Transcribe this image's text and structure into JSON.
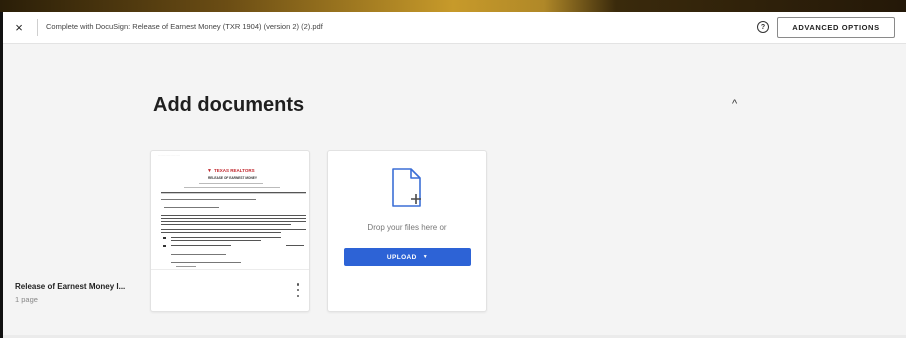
{
  "header": {
    "close_icon": "×",
    "document_title": "Complete with DocuSign: Release of Earnest Money (TXR 1904) (version 2) (2).pdf",
    "help_icon": "?",
    "advanced_options_label": "ADVANCED OPTIONS"
  },
  "section": {
    "title": "Add documents",
    "collapse_icon": "^"
  },
  "documents": [
    {
      "name": "Release of Earnest Money I...",
      "pages": "1 page",
      "more_icon": "more-vertical-icon"
    }
  ],
  "upload": {
    "icon": "file-add-icon",
    "drop_text": "Drop your files here or",
    "button_label": "UPLOAD",
    "button_caret": "▼"
  },
  "colors": {
    "accent": "#2d63d6",
    "background": "#f4f4f4",
    "header_bg": "#ffffff",
    "pdf_logo_red": "#c0262c"
  },
  "thumbnail": {
    "logo_text": "TEXAS REALTORS",
    "form_title": "RELEASE OF EARNEST MONEY"
  }
}
